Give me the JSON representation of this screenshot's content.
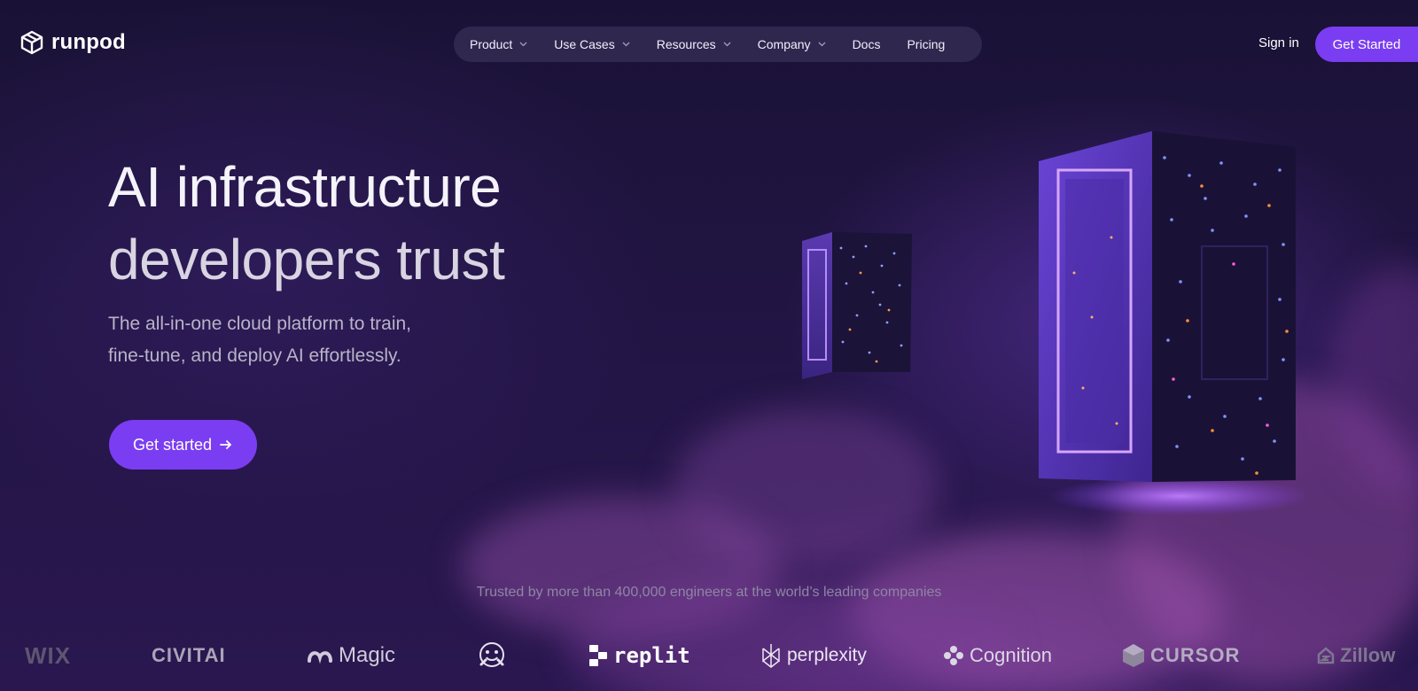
{
  "brand": {
    "name": "runpod",
    "logo_icon": "cube-icon"
  },
  "nav": {
    "items": [
      {
        "label": "Product",
        "has_dropdown": true
      },
      {
        "label": "Use Cases",
        "has_dropdown": true
      },
      {
        "label": "Resources",
        "has_dropdown": true
      },
      {
        "label": "Company",
        "has_dropdown": true
      },
      {
        "label": "Docs",
        "has_dropdown": false
      },
      {
        "label": "Pricing",
        "has_dropdown": false
      }
    ],
    "sign_in": "Sign in",
    "get_started": "Get Started"
  },
  "hero": {
    "title_line1": "AI infrastructure",
    "title_line2": "developers trust",
    "subtitle_line1": "The all-in-one cloud platform to train,",
    "subtitle_line2": "fine-tune, and deploy AI effortlessly.",
    "cta_label": "Get started",
    "cta_icon": "arrow-right-icon"
  },
  "trusted": {
    "text": "Trusted by more than 400,000 engineers at the world’s leading companies",
    "logos": [
      "WIX",
      "CIVITAI",
      "Magic",
      "replit",
      "perplexity",
      "Cognition",
      "CURSOR",
      "Zillow"
    ]
  },
  "colors": {
    "accent": "#7b3df2",
    "background": "#1a1236",
    "nav_pill": "#3c325a",
    "muted_text": "#8e86a3"
  }
}
